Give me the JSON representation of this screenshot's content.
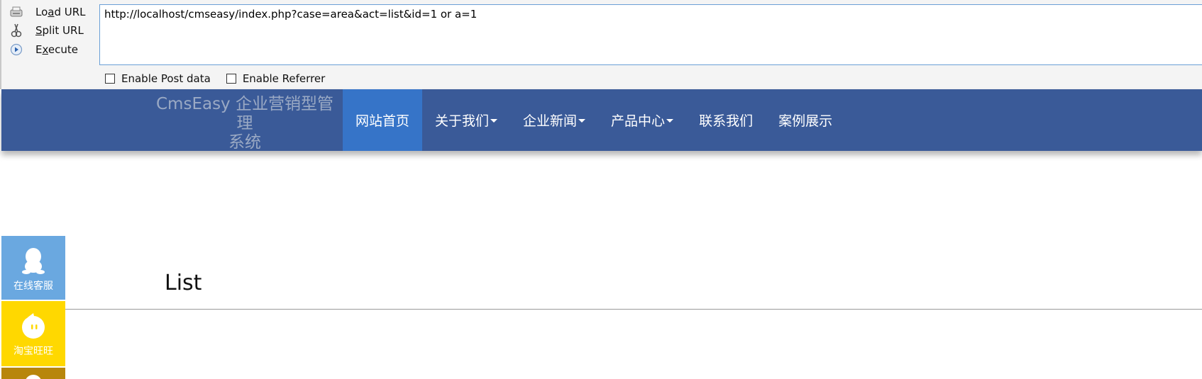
{
  "hackbar": {
    "actions": [
      {
        "label_pre": "Lo",
        "label_ul": "a",
        "label_post": "d URL",
        "icon": "load-url-icon"
      },
      {
        "label_pre": "",
        "label_ul": "S",
        "label_post": "plit URL",
        "icon": "split-url-icon"
      },
      {
        "label_pre": "E",
        "label_ul": "x",
        "label_post": "ecute",
        "icon": "execute-icon"
      }
    ],
    "url_value": "http://localhost/cmseasy/index.php?case=area&act=list&id=1 or a=1",
    "options": [
      {
        "label": "Enable Post data",
        "checked": false
      },
      {
        "label": "Enable Referrer",
        "checked": false
      }
    ]
  },
  "site": {
    "brand_line1": "CmsEasy 企业营销型管理",
    "brand_line2": "系统",
    "nav": [
      {
        "label": "网站首页",
        "active": true,
        "dropdown": false
      },
      {
        "label": "关于我们",
        "active": false,
        "dropdown": true
      },
      {
        "label": "企业新闻",
        "active": false,
        "dropdown": true
      },
      {
        "label": "产品中心",
        "active": false,
        "dropdown": true
      },
      {
        "label": "联系我们",
        "active": false,
        "dropdown": false
      },
      {
        "label": "案例展示",
        "active": false,
        "dropdown": false
      }
    ],
    "page_title": "List"
  },
  "sidebar": [
    {
      "label": "在线客服",
      "icon": "qq-icon",
      "color": "#6aa8e0"
    },
    {
      "label": "淘宝旺旺",
      "icon": "wangwang-icon",
      "color": "#ffd800"
    },
    {
      "label": "",
      "icon": "contact-icon",
      "color": "#b8860b"
    }
  ],
  "colors": {
    "navbar": "#3a5a98",
    "nav_active": "#3674c8",
    "url_border": "#6a9fd6"
  }
}
